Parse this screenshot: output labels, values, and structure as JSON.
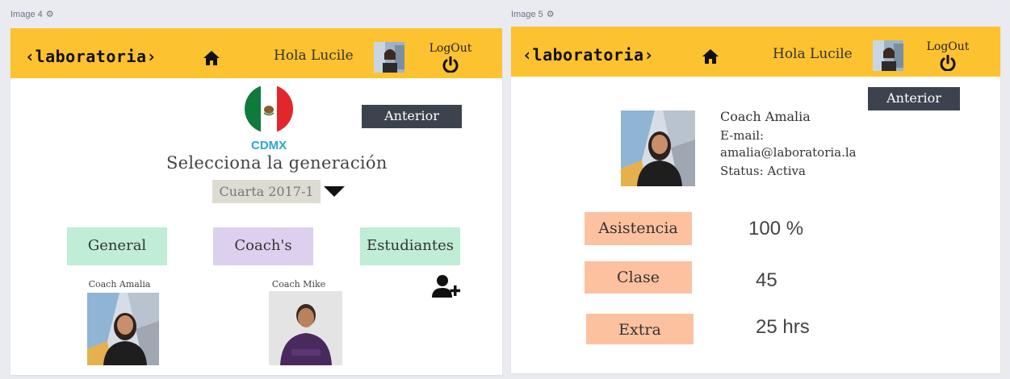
{
  "frames": [
    {
      "label": "Image 4",
      "logo": "‹laboratoria›",
      "greeting": "Hola Lucile",
      "logout": "LogOut",
      "back_button": "Anterior",
      "city": "CDMX",
      "generation_title": "Selecciona la generación",
      "generation_select": "Cuarta 2017-1",
      "tabs": [
        {
          "label": "General",
          "color": "#bfedd5"
        },
        {
          "label": "Coach's",
          "color": "#ddd0ee"
        },
        {
          "label": "Estudiantes",
          "color": "#bfedd5"
        }
      ],
      "coaches": [
        {
          "name": "Coach Amalia"
        },
        {
          "name": "Coach Mike"
        }
      ]
    },
    {
      "label": "Image 5",
      "logo": "‹laboratoria›",
      "greeting": "Hola Lucile",
      "logout": "LogOut",
      "back_button": "Anterior",
      "coach": {
        "name": "Coach Amalia",
        "email_label": "E-mail:",
        "email": "amalia@laboratoria.la",
        "status": "Status: Activa"
      },
      "stats": [
        {
          "label": "Asistencia",
          "value": "100 %"
        },
        {
          "label": "Clase",
          "value": "45"
        },
        {
          "label": "Extra",
          "value": "25 hrs"
        }
      ]
    }
  ],
  "colors": {
    "header": "#fdc22f",
    "dark_button": "#3c434f",
    "stat_label": "#fdc1a0",
    "city": "#2aa5d8"
  }
}
